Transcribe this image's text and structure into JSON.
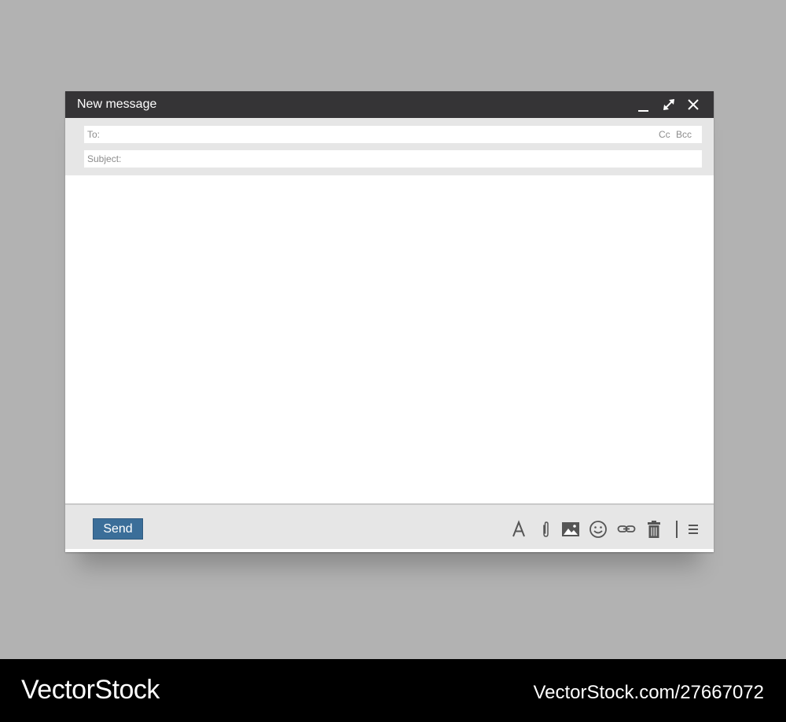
{
  "window": {
    "title": "New message",
    "controls": {
      "minimize_icon": "minimize-icon",
      "maximize_icon": "expand-arrows-icon",
      "close_icon": "close-icon"
    }
  },
  "recipients": {
    "to_label": "To:",
    "to_value": "",
    "cc_label": "Cc",
    "bcc_label": "Bcc",
    "subject_label": "Subject:",
    "subject_value": ""
  },
  "message": {
    "body": ""
  },
  "toolbar": {
    "send_label": "Send",
    "tools": [
      "font-icon",
      "paperclip-icon",
      "image-icon",
      "emoji-icon",
      "link-icon",
      "trash-icon",
      "more-options-icon"
    ]
  },
  "watermark": {
    "brand": "VectorStock",
    "url": "VectorStock.com/27667072"
  },
  "colors": {
    "page_background": "#b2b2b2",
    "titlebar": "#353436",
    "panel": "#e6e6e6",
    "send_button": "#3b6e99",
    "icon": "#555555"
  }
}
